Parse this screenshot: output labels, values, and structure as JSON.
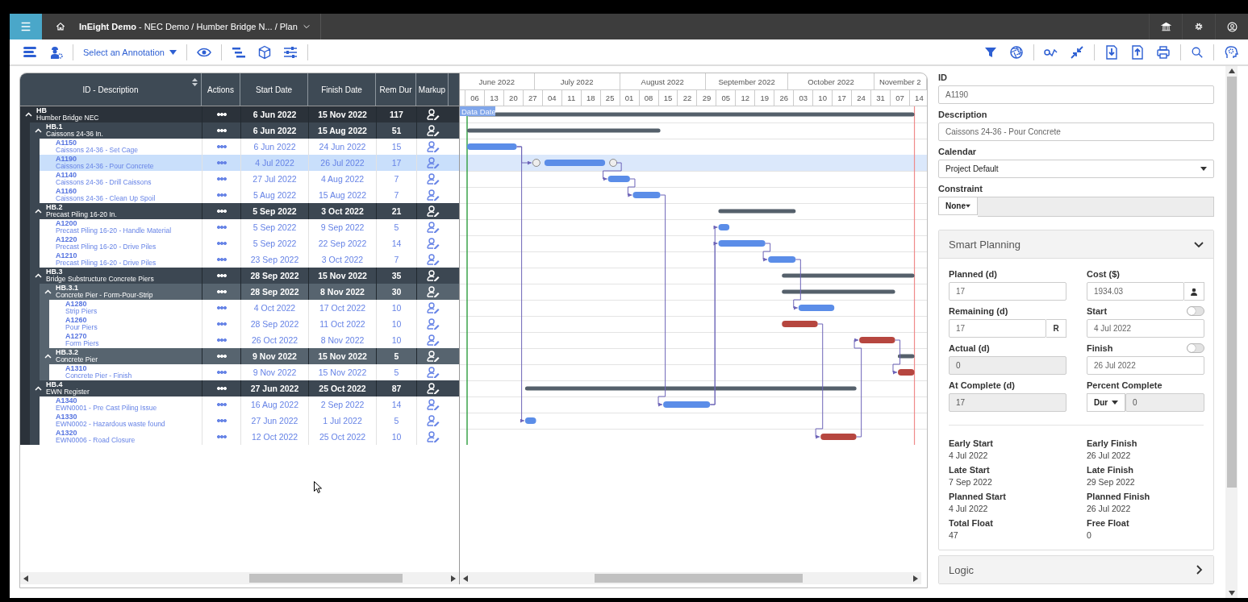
{
  "header": {
    "breadcrumb": "**InEight Demo** - NEC Demo / Humber Bridge N... / Plan"
  },
  "toolbar": {
    "annotation_select": "Select an Annotation"
  },
  "grid": {
    "columns": [
      "ID - Description",
      "Actions",
      "Start Date",
      "Finish Date",
      "Rem Dur",
      "Markup"
    ],
    "rows": [
      {
        "kind": "summary",
        "id": "HB",
        "description": "Humber Bridge NEC",
        "start": "6 Jun 2022",
        "finish": "15 Nov 2022",
        "rem_dur": "117",
        "expanded": true,
        "children": [
          {
            "kind": "summary",
            "id": "HB.1",
            "description": "Caissons 24-36 In.",
            "start": "6 Jun 2022",
            "finish": "15 Aug 2022",
            "rem_dur": "51",
            "expanded": true,
            "children": [
              {
                "kind": "activity",
                "id": "A1150",
                "description": "Caissons 24-36 - Set Cage",
                "start": "6 Jun 2022",
                "finish": "24 Jun 2022",
                "rem_dur": "15",
                "selected": false,
                "critical": false
              },
              {
                "kind": "activity",
                "id": "A1190",
                "description": "Caissons 24-36 - Pour Concrete",
                "start": "4 Jul 2022",
                "finish": "26 Jul 2022",
                "rem_dur": "17",
                "selected": true,
                "critical": false
              },
              {
                "kind": "activity",
                "id": "A1140",
                "description": "Caissons 24-36 - Drill Caissons",
                "start": "27 Jul 2022",
                "finish": "4 Aug 2022",
                "rem_dur": "7",
                "selected": false,
                "critical": false
              },
              {
                "kind": "activity",
                "id": "A1160",
                "description": "Caissons 24-36 - Clean Up Spoil",
                "start": "5 Aug 2022",
                "finish": "15 Aug 2022",
                "rem_dur": "7",
                "selected": false,
                "critical": false
              }
            ]
          },
          {
            "kind": "summary",
            "id": "HB.2",
            "description": "Precast Piling 16-20 In.",
            "start": "5 Sep 2022",
            "finish": "3 Oct 2022",
            "rem_dur": "21",
            "expanded": true,
            "children": [
              {
                "kind": "activity",
                "id": "A1200",
                "description": "Precast Piling 16-20 - Handle Material",
                "start": "5 Sep 2022",
                "finish": "9 Sep 2022",
                "rem_dur": "5",
                "selected": false,
                "critical": false
              },
              {
                "kind": "activity",
                "id": "A1220",
                "description": "Precast Piling 16-20 - Drive Piles",
                "start": "5 Sep 2022",
                "finish": "22 Sep 2022",
                "rem_dur": "14",
                "selected": false,
                "critical": false
              },
              {
                "kind": "activity",
                "id": "A1210",
                "description": "Precast Piling 16-20 - Drive Piles",
                "start": "23 Sep 2022",
                "finish": "3 Oct 2022",
                "rem_dur": "7",
                "selected": false,
                "critical": false
              }
            ]
          },
          {
            "kind": "summary",
            "id": "HB.3",
            "description": "Bridge Substructure Concrete Piers",
            "start": "28 Sep 2022",
            "finish": "15 Nov 2022",
            "rem_dur": "35",
            "expanded": true,
            "children": [
              {
                "kind": "summary",
                "id": "HB.3.1",
                "description": "Concrete Pier - Form-Pour-Strip",
                "start": "28 Sep 2022",
                "finish": "8 Nov 2022",
                "rem_dur": "30",
                "expanded": true,
                "children": [
                  {
                    "kind": "activity",
                    "id": "A1280",
                    "description": "Strip Piers",
                    "start": "4 Oct 2022",
                    "finish": "17 Oct 2022",
                    "rem_dur": "10",
                    "selected": false,
                    "critical": false
                  },
                  {
                    "kind": "activity",
                    "id": "A1260",
                    "description": "Pour Piers",
                    "start": "28 Sep 2022",
                    "finish": "11 Oct 2022",
                    "rem_dur": "10",
                    "selected": false,
                    "critical": true
                  },
                  {
                    "kind": "activity",
                    "id": "A1270",
                    "description": "Form Piers",
                    "start": "26 Oct 2022",
                    "finish": "8 Nov 2022",
                    "rem_dur": "10",
                    "selected": false,
                    "critical": true
                  }
                ]
              },
              {
                "kind": "summary",
                "id": "HB.3.2",
                "description": "Concrete Pier",
                "start": "9 Nov 2022",
                "finish": "15 Nov 2022",
                "rem_dur": "5",
                "expanded": true,
                "children": [
                  {
                    "kind": "activity",
                    "id": "A1310",
                    "description": "Concrete Pier - Finish",
                    "start": "9 Nov 2022",
                    "finish": "15 Nov 2022",
                    "rem_dur": "5",
                    "selected": false,
                    "critical": true
                  }
                ]
              }
            ]
          },
          {
            "kind": "summary",
            "id": "HB.4",
            "description": "EWN Register",
            "start": "27 Jun 2022",
            "finish": "25 Oct 2022",
            "rem_dur": "87",
            "expanded": true,
            "children": [
              {
                "kind": "activity",
                "id": "A1340",
                "description": "EWN0001 - Pre Cast Piling Issue",
                "start": "16 Aug 2022",
                "finish": "2 Sep 2022",
                "rem_dur": "14",
                "selected": false,
                "critical": false
              },
              {
                "kind": "activity",
                "id": "A1330",
                "description": "EWN0002 - Hazardous waste found",
                "start": "27 Jun 2022",
                "finish": "1 Jul 2022",
                "rem_dur": "5",
                "selected": false,
                "critical": false
              },
              {
                "kind": "activity",
                "id": "A1320",
                "description": "EWN0006 - Road Closure",
                "start": "12 Oct 2022",
                "finish": "25 Oct 2022",
                "rem_dur": "10",
                "selected": false,
                "critical": true
              }
            ]
          }
        ]
      }
    ]
  },
  "gantt": {
    "months": [
      "June 2022",
      "July 2022",
      "August 2022",
      "September 2022",
      "October 2022",
      "November 2"
    ],
    "weeks": [
      "06",
      "13",
      "20",
      "27",
      "04",
      "11",
      "18",
      "25",
      "01",
      "08",
      "15",
      "22",
      "29",
      "05",
      "12",
      "19",
      "26",
      "03",
      "10",
      "17",
      "24",
      "31",
      "07",
      "14"
    ],
    "data_date_label": "Data Date"
  },
  "details": {
    "id": {
      "label": "ID",
      "value": "A1190"
    },
    "description": {
      "label": "Description",
      "value": "Caissons 24-36 - Pour Concrete"
    },
    "calendar": {
      "label": "Calendar",
      "value": "Project Default"
    },
    "constraint": {
      "label": "Constraint",
      "type": "None"
    },
    "smart_planning": {
      "title": "Smart Planning",
      "expanded": true,
      "fields": [
        {
          "kind": "input",
          "label": "Planned (d)",
          "value": "17"
        },
        {
          "kind": "input-person",
          "label": "Cost ($)",
          "value": "1934.03"
        },
        {
          "kind": "input-button",
          "label": "Remaining (d)",
          "value": "17",
          "button": "R"
        },
        {
          "kind": "toggle-input",
          "label": "Start",
          "value": "4 Jul 2022",
          "on": false
        },
        {
          "kind": "disabled",
          "label": "Actual (d)",
          "value": "0"
        },
        {
          "kind": "toggle-input",
          "label": "Finish",
          "value": "26 Jul 2022",
          "on": false
        },
        {
          "kind": "disabled",
          "label": "At Complete (d)",
          "value": "17"
        },
        {
          "kind": "select-disabled",
          "label": "Percent Complete",
          "option": "Dur",
          "value": "0"
        }
      ],
      "stats": [
        {
          "label": "Early Start",
          "value": "4 Jul 2022"
        },
        {
          "label": "Early Finish",
          "value": "26 Jul 2022"
        },
        {
          "label": "Late Start",
          "value": "7 Sep 2022"
        },
        {
          "label": "Late Finish",
          "value": "29 Sep 2022"
        },
        {
          "label": "Planned Start",
          "value": "4 Jul 2022"
        },
        {
          "label": "Planned Finish",
          "value": "26 Jul 2022"
        },
        {
          "label": "Total Float",
          "value": "47"
        },
        {
          "label": "Free Float",
          "value": "0"
        }
      ]
    },
    "logic": {
      "title": "Logic",
      "expanded": false
    }
  }
}
